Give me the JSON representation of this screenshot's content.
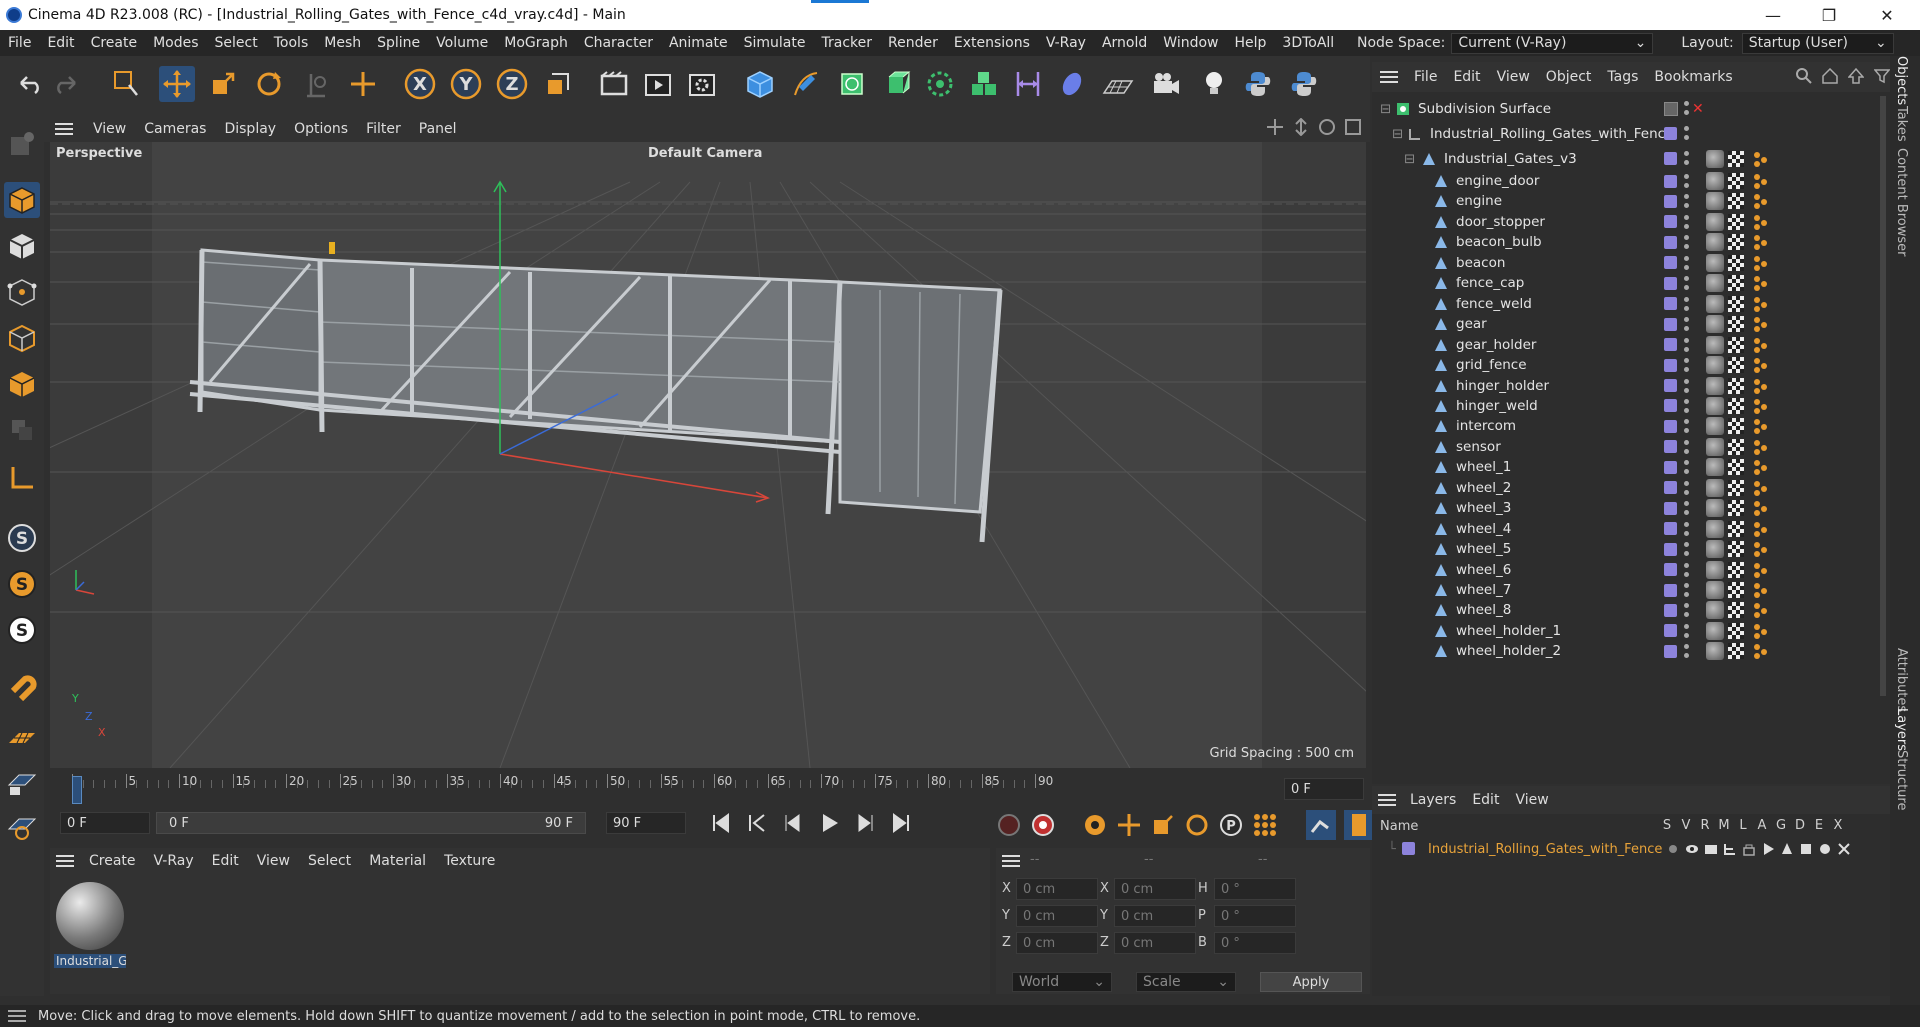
{
  "window": {
    "title": "Cinema 4D R23.008 (RC) - [Industrial_Rolling_Gates_with_Fence_c4d_vray.c4d] - Main"
  },
  "menubar": {
    "items": [
      "File",
      "Edit",
      "Create",
      "Modes",
      "Select",
      "Tools",
      "Mesh",
      "Spline",
      "Volume",
      "MoGraph",
      "Character",
      "Animate",
      "Simulate",
      "Tracker",
      "Render",
      "Extensions",
      "V-Ray",
      "Arnold",
      "Window",
      "Help",
      "3DToAll"
    ],
    "node_space_label": "Node Space:",
    "node_space_value": "Current (V-Ray)",
    "layout_label": "Layout:",
    "layout_value": "Startup (User)"
  },
  "viewport": {
    "menu": [
      "View",
      "Cameras",
      "Display",
      "Options",
      "Filter",
      "Panel"
    ],
    "label": "Perspective",
    "camera": "Default Camera",
    "grid_spacing": "Grid Spacing : 500 cm",
    "axes": {
      "y": "Y",
      "z": "Z",
      "x": "X"
    }
  },
  "timeline": {
    "ticks": [
      "0",
      "5",
      "10",
      "15",
      "20",
      "25",
      "30",
      "35",
      "40",
      "45",
      "50",
      "55",
      "60",
      "65",
      "70",
      "75",
      "80",
      "85",
      "90"
    ],
    "frame_field": "0 F"
  },
  "transport": {
    "start": "0 F",
    "range_start": "0 F",
    "range_end": "90 F",
    "end": "90 F"
  },
  "material_manager": {
    "menu": [
      "Create",
      "V-Ray",
      "Edit",
      "View",
      "Select",
      "Material",
      "Texture"
    ],
    "material_name": "Industrial_G"
  },
  "coords": {
    "header": [
      "--",
      "--",
      "--"
    ],
    "rows": [
      {
        "a": "X",
        "av": "0 cm",
        "b": "X",
        "bv": "0 cm",
        "c": "H",
        "cv": "0 °"
      },
      {
        "a": "Y",
        "av": "0 cm",
        "b": "Y",
        "bv": "0 cm",
        "c": "P",
        "cv": "0 °"
      },
      {
        "a": "Z",
        "av": "0 cm",
        "b": "Z",
        "bv": "0 cm",
        "c": "B",
        "cv": "0 °"
      }
    ],
    "world": "World",
    "scale": "Scale",
    "apply": "Apply"
  },
  "object_manager": {
    "menu": [
      "File",
      "Edit",
      "View",
      "Object",
      "Tags",
      "Bookmarks"
    ],
    "root": "Subdivision Surface",
    "group": "Industrial_Rolling_Gates_with_Fence",
    "subgroup": "Industrial_Gates_v3",
    "objects": [
      "engine_door",
      "engine",
      "door_stopper",
      "beacon_bulb",
      "beacon",
      "fence_cap",
      "fence_weld",
      "gear",
      "gear_holder",
      "grid_fence",
      "hinger_holder",
      "hinger_weld",
      "intercom",
      "sensor",
      "wheel_1",
      "wheel_2",
      "wheel_3",
      "wheel_4",
      "wheel_5",
      "wheel_6",
      "wheel_7",
      "wheel_8",
      "wheel_holder_1",
      "wheel_holder_2"
    ]
  },
  "layer_manager": {
    "menu": [
      "Layers",
      "Edit",
      "View"
    ],
    "col_name": "Name",
    "cols": [
      "S",
      "V",
      "R",
      "M",
      "L",
      "A",
      "G",
      "D",
      "E",
      "X"
    ],
    "layer": "Industrial_Rolling_Gates_with_Fence"
  },
  "right_tabs": [
    "Objects",
    "Takes",
    "Content Browser",
    "Attributes",
    "Layers",
    "Structure"
  ],
  "status": "Move: Click and drag to move elements. Hold down SHIFT to quantize movement / add to the selection in point mode, CTRL to remove.",
  "colors": {
    "accent": "#2c4f7a",
    "layer_text": "#e8a33a",
    "tag_purple": "#8d83dc"
  }
}
